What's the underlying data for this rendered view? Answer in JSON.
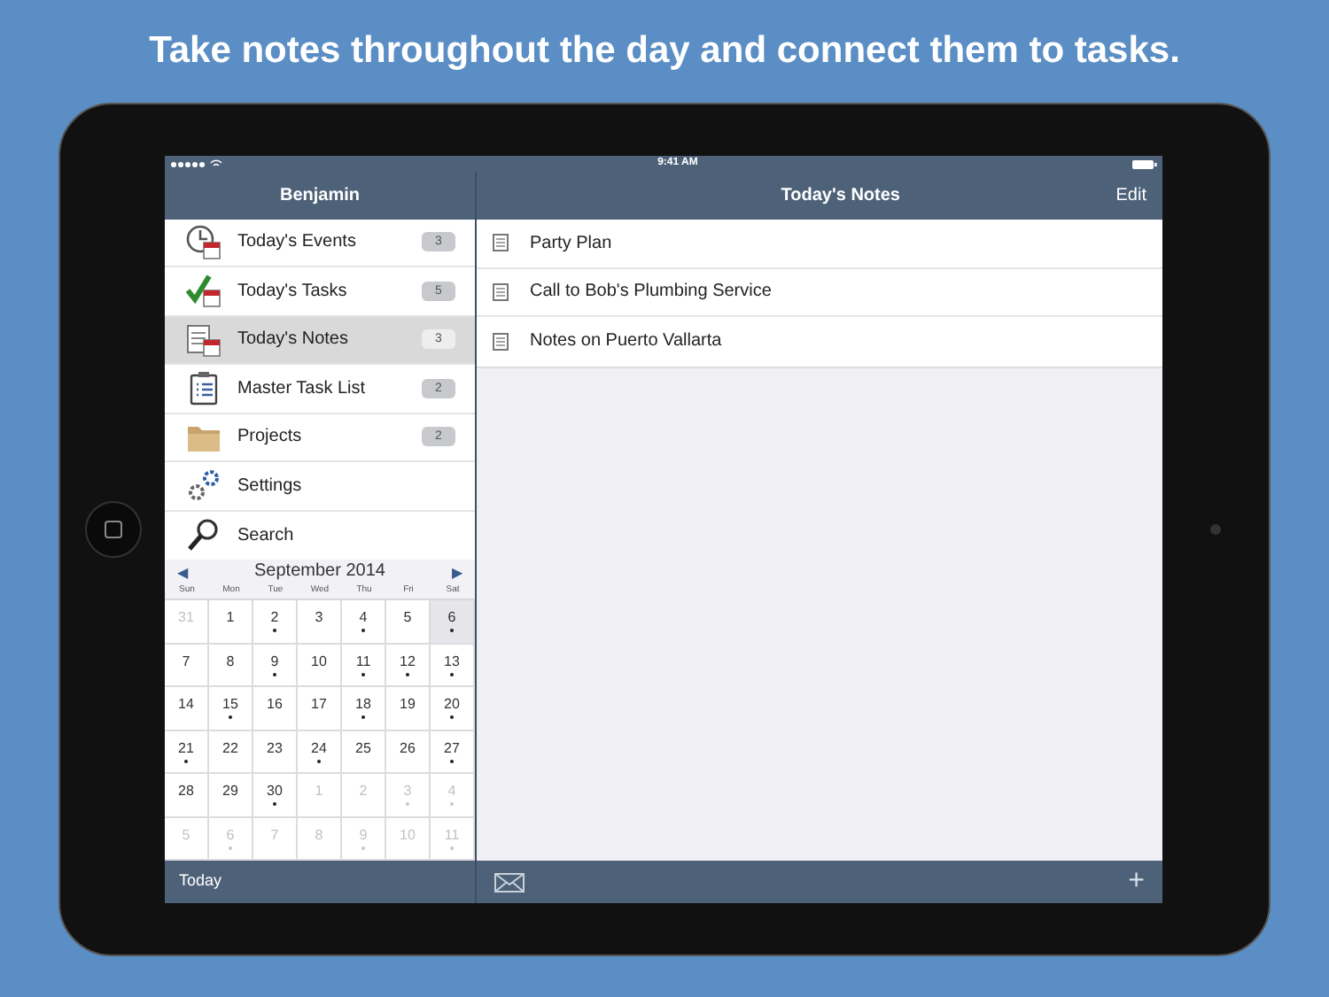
{
  "headline": "Take notes throughout the day and connect them to tasks.",
  "status_bar": {
    "time": "9:41 AM"
  },
  "sidebar": {
    "title": "Benjamin",
    "items": [
      {
        "label": "Today's Events",
        "badge": "3",
        "selected": false
      },
      {
        "label": "Today's Tasks",
        "badge": "5",
        "selected": false
      },
      {
        "label": "Today's Notes",
        "badge": "3",
        "selected": true
      },
      {
        "label": "Master Task List",
        "badge": "2",
        "selected": false
      },
      {
        "label": "Projects",
        "badge": "2",
        "selected": false
      },
      {
        "label": "Settings",
        "selected": false
      },
      {
        "label": "Search",
        "selected": false
      }
    ]
  },
  "calendar": {
    "prev": "◀",
    "next": "▶",
    "month": "September 2014",
    "weekdays": [
      "Sun",
      "Mon",
      "Tue",
      "Wed",
      "Thu",
      "Fri",
      "Sat"
    ],
    "days": [
      {
        "day": "31",
        "muted": true,
        "dot": false,
        "selected": false
      },
      {
        "day": "1",
        "muted": false,
        "dot": false,
        "selected": false
      },
      {
        "day": "2",
        "muted": false,
        "dot": true,
        "selected": false
      },
      {
        "day": "3",
        "muted": false,
        "dot": false,
        "selected": false
      },
      {
        "day": "4",
        "muted": false,
        "dot": true,
        "selected": false
      },
      {
        "day": "5",
        "muted": false,
        "dot": false,
        "selected": false
      },
      {
        "day": "6",
        "muted": false,
        "dot": true,
        "selected": true
      },
      {
        "day": "7",
        "muted": false,
        "dot": false,
        "selected": false
      },
      {
        "day": "8",
        "muted": false,
        "dot": false,
        "selected": false
      },
      {
        "day": "9",
        "muted": false,
        "dot": true,
        "selected": false
      },
      {
        "day": "10",
        "muted": false,
        "dot": false,
        "selected": false
      },
      {
        "day": "11",
        "muted": false,
        "dot": true,
        "selected": false
      },
      {
        "day": "12",
        "muted": false,
        "dot": true,
        "selected": false
      },
      {
        "day": "13",
        "muted": false,
        "dot": true,
        "selected": false
      },
      {
        "day": "14",
        "muted": false,
        "dot": false,
        "selected": false
      },
      {
        "day": "15",
        "muted": false,
        "dot": true,
        "selected": false
      },
      {
        "day": "16",
        "muted": false,
        "dot": false,
        "selected": false
      },
      {
        "day": "17",
        "muted": false,
        "dot": false,
        "selected": false
      },
      {
        "day": "18",
        "muted": false,
        "dot": true,
        "selected": false
      },
      {
        "day": "19",
        "muted": false,
        "dot": false,
        "selected": false
      },
      {
        "day": "20",
        "muted": false,
        "dot": true,
        "selected": false
      },
      {
        "day": "21",
        "muted": false,
        "dot": true,
        "selected": false
      },
      {
        "day": "22",
        "muted": false,
        "dot": false,
        "selected": false
      },
      {
        "day": "23",
        "muted": false,
        "dot": false,
        "selected": false
      },
      {
        "day": "24",
        "muted": false,
        "dot": true,
        "selected": false
      },
      {
        "day": "25",
        "muted": false,
        "dot": false,
        "selected": false
      },
      {
        "day": "26",
        "muted": false,
        "dot": false,
        "selected": false
      },
      {
        "day": "27",
        "muted": false,
        "dot": true,
        "selected": false
      },
      {
        "day": "28",
        "muted": false,
        "dot": false,
        "selected": false
      },
      {
        "day": "29",
        "muted": false,
        "dot": false,
        "selected": false
      },
      {
        "day": "30",
        "muted": false,
        "dot": true,
        "selected": false
      },
      {
        "day": "1",
        "muted": true,
        "dot": false,
        "selected": false
      },
      {
        "day": "2",
        "muted": true,
        "dot": false,
        "selected": false
      },
      {
        "day": "3",
        "muted": true,
        "dot": true,
        "selected": false
      },
      {
        "day": "4",
        "muted": true,
        "dot": true,
        "selected": false
      },
      {
        "day": "5",
        "muted": true,
        "dot": false,
        "selected": false
      },
      {
        "day": "6",
        "muted": true,
        "dot": true,
        "selected": false
      },
      {
        "day": "7",
        "muted": true,
        "dot": false,
        "selected": false
      },
      {
        "day": "8",
        "muted": true,
        "dot": false,
        "selected": false
      },
      {
        "day": "9",
        "muted": true,
        "dot": true,
        "selected": false
      },
      {
        "day": "10",
        "muted": true,
        "dot": false,
        "selected": false
      },
      {
        "day": "11",
        "muted": true,
        "dot": true,
        "selected": false
      }
    ]
  },
  "sidebar_footer": {
    "button": "Today"
  },
  "main": {
    "title": "Today's Notes",
    "edit": "Edit",
    "notes": [
      "Party Plan",
      "Call to Bob's Plumbing Service",
      "Notes on Puerto Vallarta"
    ],
    "add": "+"
  }
}
